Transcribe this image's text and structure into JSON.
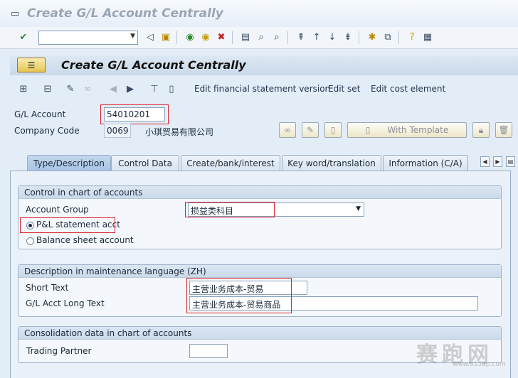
{
  "window": {
    "title": "Create G/L Account Centrally"
  },
  "toolbar": {
    "command_field_value": "",
    "icons": [
      "enter-icon",
      "command-dropdown-icon",
      "back-icon",
      "save-icon",
      "back-green-icon",
      "exit-icon",
      "cancel-icon",
      "print-icon",
      "find-icon",
      "find-next-icon",
      "first-page-icon",
      "prev-page-icon",
      "next-page-icon",
      "last-page-icon",
      "create-session-icon",
      "shortcut-icon",
      "help-icon",
      "customize-layout-icon"
    ]
  },
  "screen": {
    "title": "Create G/L Account Centrally"
  },
  "app_toolbar": {
    "edit_fs_version": "Edit financial statement version",
    "edit_set": "Edit set",
    "edit_cost_element": "Edit cost element"
  },
  "header": {
    "gl_account_label": "G/L Account",
    "gl_account_value": "54010201",
    "company_code_label": "Company Code",
    "company_code_value": "0069",
    "company_name": "小琪贸易有限公司",
    "with_template": "With Template"
  },
  "tabs": [
    {
      "label": "Type/Description",
      "active": true
    },
    {
      "label": "Control Data",
      "active": false
    },
    {
      "label": "Create/bank/interest",
      "active": false
    },
    {
      "label": "Key word/translation",
      "active": false
    },
    {
      "label": "Information (C/A)",
      "active": false
    }
  ],
  "control_group": {
    "title": "Control in chart of accounts",
    "account_group_label": "Account Group",
    "account_group_value": "损益类科目",
    "pl_label": "P&L statement acct",
    "bs_label": "Balance sheet account"
  },
  "description_group": {
    "title": "Description in maintenance language (ZH)",
    "short_text_label": "Short Text",
    "short_text_value": "主营业务成本-贸易",
    "long_text_label": "G/L Acct Long Text",
    "long_text_value": "主营业务成本-贸易商品"
  },
  "consolidation_group": {
    "title": "Consolidation data in chart of accounts",
    "trading_partner_label": "Trading Partner",
    "trading_partner_value": ""
  },
  "watermark": {
    "text": "赛跑网",
    "url": "www.915ap.com"
  },
  "colors": {
    "highlight": "#d9232a",
    "tab_active": "#a9c4e3",
    "background": "#e3edf8"
  }
}
